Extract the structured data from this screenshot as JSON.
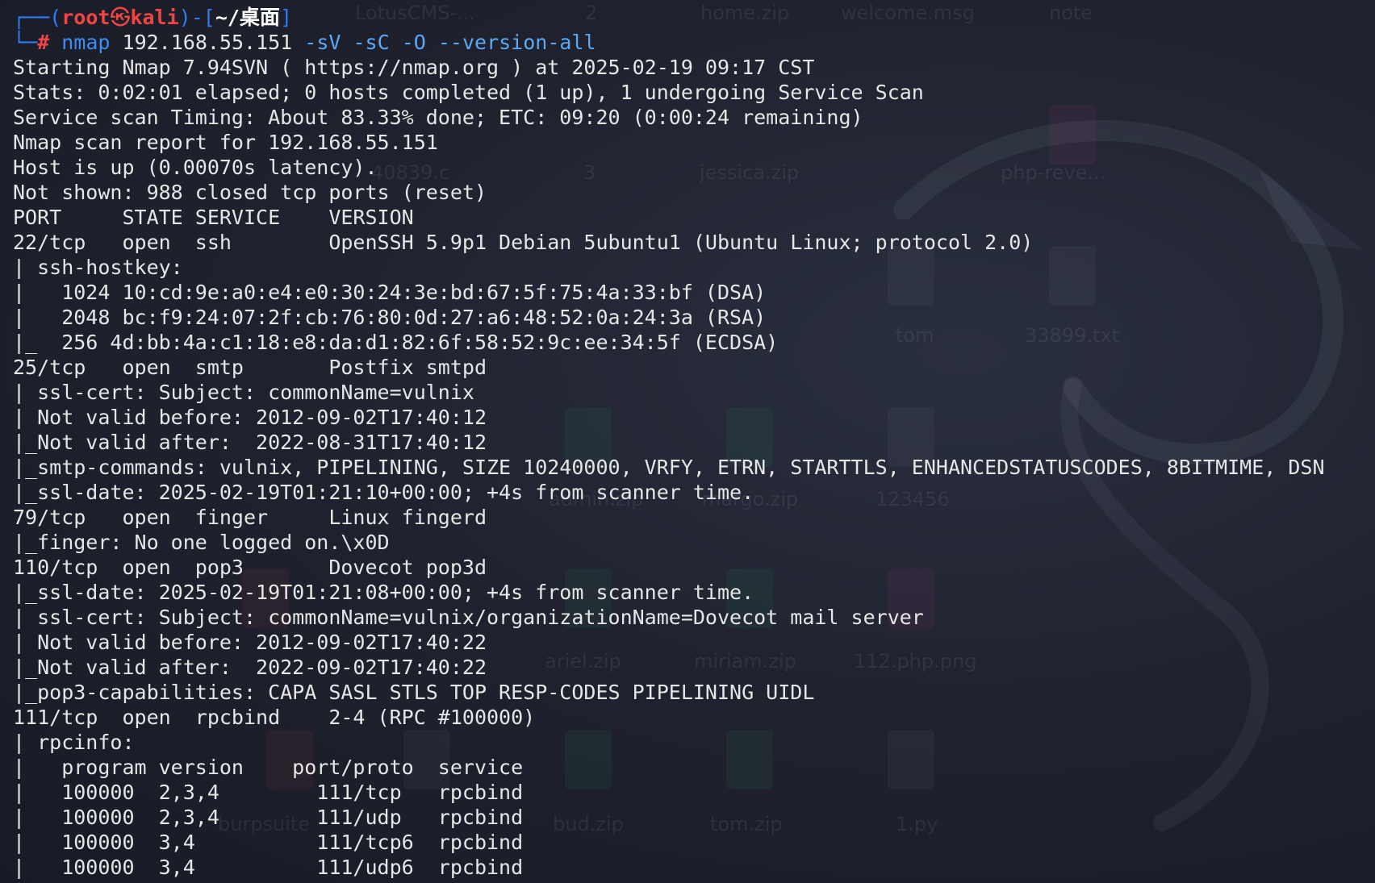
{
  "prompt": {
    "frame_open": "┌──(",
    "user": "root",
    "skull": "㉿",
    "host": "kali",
    "frame_mid": ")-[",
    "path": "~/桌面",
    "frame_close": "]",
    "frame_bottom": "└─",
    "hash": "#",
    "command": "nmap",
    "target": "192.168.55.151",
    "flags": "-sV -sC -O --version-all"
  },
  "output_lines": [
    "Starting Nmap 7.94SVN ( https://nmap.org ) at 2025-02-19 09:17 CST",
    "Stats: 0:02:01 elapsed; 0 hosts completed (1 up), 1 undergoing Service Scan",
    "Service scan Timing: About 83.33% done; ETC: 09:20 (0:00:24 remaining)",
    "Nmap scan report for 192.168.55.151",
    "Host is up (0.00070s latency).",
    "Not shown: 988 closed tcp ports (reset)",
    "PORT     STATE SERVICE    VERSION",
    "22/tcp   open  ssh        OpenSSH 5.9p1 Debian 5ubuntu1 (Ubuntu Linux; protocol 2.0)",
    "| ssh-hostkey: ",
    "|   1024 10:cd:9e:a0:e4:e0:30:24:3e:bd:67:5f:75:4a:33:bf (DSA)",
    "|   2048 bc:f9:24:07:2f:cb:76:80:0d:27:a6:48:52:0a:24:3a (RSA)",
    "|_  256 4d:bb:4a:c1:18:e8:da:d1:82:6f:58:52:9c:ee:34:5f (ECDSA)",
    "25/tcp   open  smtp       Postfix smtpd",
    "| ssl-cert: Subject: commonName=vulnix",
    "| Not valid before: 2012-09-02T17:40:12",
    "|_Not valid after:  2022-08-31T17:40:12",
    "|_smtp-commands: vulnix, PIPELINING, SIZE 10240000, VRFY, ETRN, STARTTLS, ENHANCEDSTATUSCODES, 8BITMIME, DSN",
    "|_ssl-date: 2025-02-19T01:21:10+00:00; +4s from scanner time.",
    "79/tcp   open  finger     Linux fingerd",
    "|_finger: No one logged on.\\x0D",
    "110/tcp  open  pop3       Dovecot pop3d",
    "|_ssl-date: 2025-02-19T01:21:08+00:00; +4s from scanner time.",
    "| ssl-cert: Subject: commonName=vulnix/organizationName=Dovecot mail server",
    "| Not valid before: 2012-09-02T17:40:22",
    "|_Not valid after:  2022-09-02T17:40:22",
    "|_pop3-capabilities: CAPA SASL STLS TOP RESP-CODES PIPELINING UIDL",
    "111/tcp  open  rpcbind    2-4 (RPC #100000)",
    "| rpcinfo: ",
    "|   program version    port/proto  service",
    "|   100000  2,3,4        111/tcp   rpcbind",
    "|   100000  2,3,4        111/udp   rpcbind",
    "|   100000  3,4          111/tcp6  rpcbind",
    "|   100000  3,4          111/udp6  rpcbind"
  ],
  "desktop_labels": [
    "LotusCMS-...",
    "2",
    "home.zip",
    "welcome.msg",
    "note",
    "40839.c",
    "3",
    "jessica.zip",
    "php-reve...",
    "tom",
    "33899.txt",
    "admin.zip",
    "margo.zip",
    "123456",
    "ariel.zip",
    "miriam.zip",
    "112.php.png",
    "burpsuite",
    "bud.zip",
    "tom.zip",
    "1.py"
  ],
  "colors": {
    "background": "#1b1f2c",
    "text": "#e6e6e6",
    "prompt_frame": "#2f7cf6",
    "prompt_user": "#f04545",
    "command": "#3f8cf2",
    "flags": "#5aa9f7"
  }
}
